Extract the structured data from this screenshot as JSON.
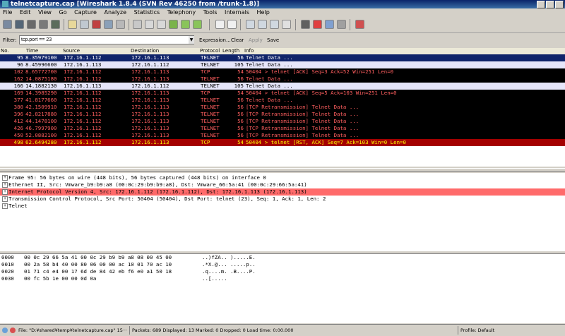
{
  "window": {
    "title": "telnetcapture.cap   [Wireshark 1.8.4  (SVN Rev 46250 from /trunk-1.8)]"
  },
  "menu": [
    "File",
    "Edit",
    "View",
    "Go",
    "Capture",
    "Analyze",
    "Statistics",
    "Telephony",
    "Tools",
    "Internals",
    "Help"
  ],
  "filter": {
    "label": "Filter:",
    "value": "tcp.port == 23",
    "expression": "Expression...",
    "clear": "Clear",
    "apply": "Apply",
    "save": "Save"
  },
  "columns": [
    "No.",
    "Time",
    "Source",
    "Destination",
    "Protocol",
    "Length",
    "Info"
  ],
  "packets": [
    {
      "no": "95",
      "time": "8.35979100",
      "src": "172.16.1.112",
      "dst": "172.16.1.113",
      "proto": "TELNET",
      "len": "56",
      "info": "Telnet Data ...",
      "bg": "#10246a",
      "fg": "#ffffff"
    },
    {
      "no": "96",
      "time": "8.45996600",
      "src": "172.16.1.113",
      "dst": "172.16.1.112",
      "proto": "TELNET",
      "len": "105",
      "info": "Telnet Data ...",
      "bg": "#e6e6fa",
      "fg": "#000000"
    },
    {
      "no": "102",
      "time": "8.65772700",
      "src": "172.16.1.112",
      "dst": "172.16.1.113",
      "proto": "TCP",
      "len": "54",
      "info": "50404 > telnet [ACK] Seq=3 Ack=52 Win=251 Len=0",
      "bg": "#000000",
      "fg": "#ff5f5f"
    },
    {
      "no": "162",
      "time": "14.0875180",
      "src": "172.16.1.112",
      "dst": "172.16.1.113",
      "proto": "TELNET",
      "len": "56",
      "info": "Telnet Data ...",
      "bg": "#000000",
      "fg": "#ff5f5f"
    },
    {
      "no": "166",
      "time": "14.1882130",
      "src": "172.16.1.113",
      "dst": "172.16.1.112",
      "proto": "TELNET",
      "len": "105",
      "info": "Telnet Data ...",
      "bg": "#e6e6fa",
      "fg": "#000000"
    },
    {
      "no": "169",
      "time": "14.3985290",
      "src": "172.16.1.112",
      "dst": "172.16.1.113",
      "proto": "TCP",
      "len": "54",
      "info": "50404 > telnet [ACK] Seq=5 Ack=103 Win=251 Len=0",
      "bg": "#000000",
      "fg": "#ff5f5f"
    },
    {
      "no": "377",
      "time": "41.8177660",
      "src": "172.16.1.112",
      "dst": "172.16.1.113",
      "proto": "TELNET",
      "len": "56",
      "info": "Telnet Data ...",
      "bg": "#000000",
      "fg": "#ff5f5f"
    },
    {
      "no": "380",
      "time": "42.1509910",
      "src": "172.16.1.112",
      "dst": "172.16.1.113",
      "proto": "TELNET",
      "len": "56",
      "info": "[TCP Retransmission] Telnet Data ...",
      "bg": "#000000",
      "fg": "#ff5f5f"
    },
    {
      "no": "396",
      "time": "42.8217880",
      "src": "172.16.1.112",
      "dst": "172.16.1.113",
      "proto": "TELNET",
      "len": "56",
      "info": "[TCP Retransmission] Telnet Data ...",
      "bg": "#000000",
      "fg": "#ff5f5f"
    },
    {
      "no": "412",
      "time": "44.1478100",
      "src": "172.16.1.112",
      "dst": "172.16.1.113",
      "proto": "TELNET",
      "len": "56",
      "info": "[TCP Retransmission] Telnet Data ...",
      "bg": "#000000",
      "fg": "#ff5f5f"
    },
    {
      "no": "426",
      "time": "46.7997900",
      "src": "172.16.1.112",
      "dst": "172.16.1.113",
      "proto": "TELNET",
      "len": "56",
      "info": "[TCP Retransmission] Telnet Data ...",
      "bg": "#000000",
      "fg": "#ff5f5f"
    },
    {
      "no": "450",
      "time": "52.0882100",
      "src": "172.16.1.112",
      "dst": "172.16.1.113",
      "proto": "TELNET",
      "len": "56",
      "info": "[TCP Retransmission] Telnet Data ...",
      "bg": "#000000",
      "fg": "#ff5f5f"
    },
    {
      "no": "498",
      "time": "62.6494280",
      "src": "172.16.1.112",
      "dst": "172.16.1.113",
      "proto": "TCP",
      "len": "54",
      "info": "50404 > telnet [RST, ACK] Seq=7 Ack=103 Win=0 Len=0",
      "bg": "#a40000",
      "fg": "#ffff00"
    }
  ],
  "details": [
    {
      "text": "Frame 95: 56 bytes on wire (448 bits), 56 bytes captured (448 bits) on interface 0",
      "bg": "#ffffff"
    },
    {
      "text": "Ethernet II, Src: Vmware_b9:b9:a8 (00:0c:29:b9:b9:a8), Dst: Vmware_66:5a:41 (00:0c:29:66:5a:41)",
      "bg": "#ffffff"
    },
    {
      "text": "Internet Protocol Version 4, Src: 172.16.1.112 (172.16.1.112), Dst: 172.16.1.113 (172.16.1.113)",
      "bg": "#ff6a6a"
    },
    {
      "text": "Transmission Control Protocol, Src Port: 50404 (50404), Dst Port: telnet (23), Seq: 1, Ack: 1, Len: 2",
      "bg": "#ffffff"
    },
    {
      "text": "Telnet",
      "bg": "#ffffff"
    }
  ],
  "hex": [
    {
      "off": "0000",
      "bytes": "00 0c 29 66 5a 41 00 0c  29 b9 b9 a8 08 00 45 00",
      "ascii": "..)fZA.. ).....E."
    },
    {
      "off": "0010",
      "bytes": "00 2a 58 b4 40 00 80 06  00 00 ac 10 01 70 ac 10",
      "ascii": ".*X.@... .....p.."
    },
    {
      "off": "0020",
      "bytes": "01 71 c4 e4 00 17 6d de  84 42 eb f6 e0 a1 50 18",
      "ascii": ".q....m. .B....P."
    },
    {
      "off": "0030",
      "bytes": "00 fc 5b 1e 00 00 0d 0a",
      "ascii": "..[....."
    }
  ],
  "status": {
    "file": "File: \"D:¥shared¥temp¥telnetcapture.cap\" 15···",
    "packets": "Packets: 689 Displayed: 13 Marked: 0 Dropped: 0 Load time: 0:00.000",
    "profile": "Profile: Default"
  }
}
